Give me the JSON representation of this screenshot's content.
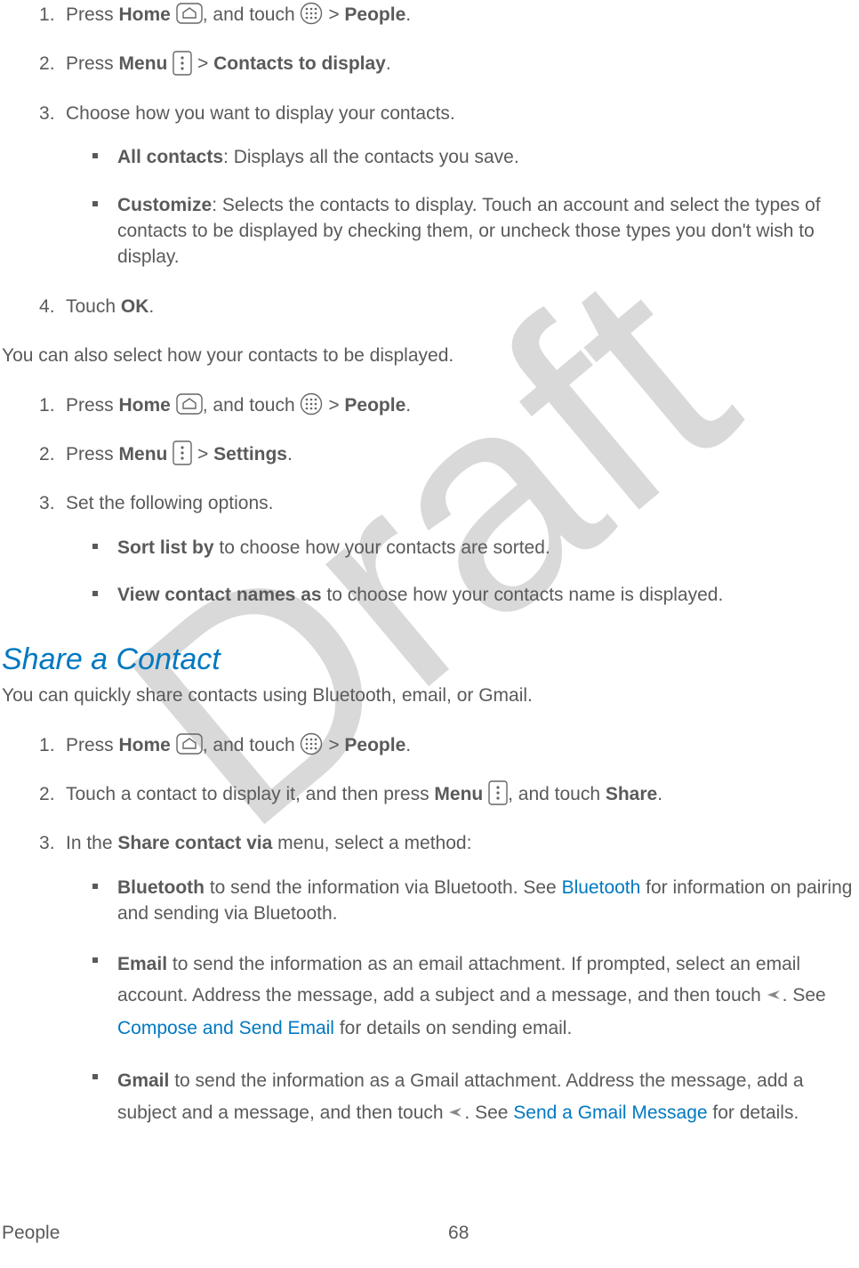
{
  "watermark": "Draft",
  "listA": {
    "s1": {
      "t1": "Press ",
      "home": "Home",
      "t2": ", and touch ",
      "t3": " > ",
      "people": "People",
      "t4": "."
    },
    "s2": {
      "t1": "Press ",
      "menu": "Menu",
      "t2": " > ",
      "ctd": "Contacts to display",
      "t3": "."
    },
    "s3": {
      "t1": "Choose how you want to display your contacts."
    },
    "s3b": {
      "i1": {
        "b": "All contacts",
        "t": ": Displays all the contacts you save."
      },
      "i2": {
        "b": "Customize",
        "t": ": Selects the contacts to display. Touch an account and select the types of contacts to be displayed by checking them, or uncheck those types you don't wish to display."
      }
    },
    "s4": {
      "t1": "Touch ",
      "ok": "OK",
      "t2": "."
    }
  },
  "paraB": "You can also select how your contacts to be displayed.",
  "listB": {
    "s1": {
      "t1": "Press ",
      "home": "Home",
      "t2": ", and touch ",
      "t3": " > ",
      "people": "People",
      "t4": "."
    },
    "s2": {
      "t1": "Press ",
      "menu": "Menu",
      "t2": " > ",
      "settings": "Settings",
      "t3": "."
    },
    "s3": {
      "t1": "Set the following options."
    },
    "s3b": {
      "i1": {
        "b": "Sort list by",
        "t": " to choose how your contacts are sorted."
      },
      "i2": {
        "b": "View contact names as",
        "t": " to choose how your contacts name is displayed."
      }
    }
  },
  "heading": "Share a Contact",
  "paraC": "You can quickly share contacts using Bluetooth, email, or Gmail.",
  "listC": {
    "s1": {
      "t1": "Press ",
      "home": "Home",
      "t2": ", and touch ",
      "t3": " > ",
      "people": "People",
      "t4": "."
    },
    "s2": {
      "t1": "Touch a contact to display it, and then press ",
      "menu": "Menu",
      "t2": ", and touch ",
      "share": "Share",
      "t3": "."
    },
    "s3": {
      "t1": "In the ",
      "scv": "Share contact via",
      "t2": " menu, select a method:"
    },
    "s3b": {
      "i1": {
        "b": "Bluetooth",
        "t1": " to send the information via Bluetooth. See ",
        "link": "Bluetooth",
        "t2": " for information on pairing and sending via Bluetooth."
      },
      "i2": {
        "b": "Email",
        "t1": " to send the information as an email attachment. If prompted, select an email account. Address the message, add a subject and a message, and then touch ",
        "t2": ". See ",
        "link": "Compose and Send Email",
        "t3": " for details on sending email."
      },
      "i3": {
        "b": "Gmail",
        "t1": " to send the information as a Gmail attachment. Address the message, add a subject and a message, and then touch ",
        "t2": ". See ",
        "link": "Send a Gmail Message",
        "t3": " for details."
      }
    }
  },
  "footer": {
    "section": "People",
    "page": "68"
  }
}
